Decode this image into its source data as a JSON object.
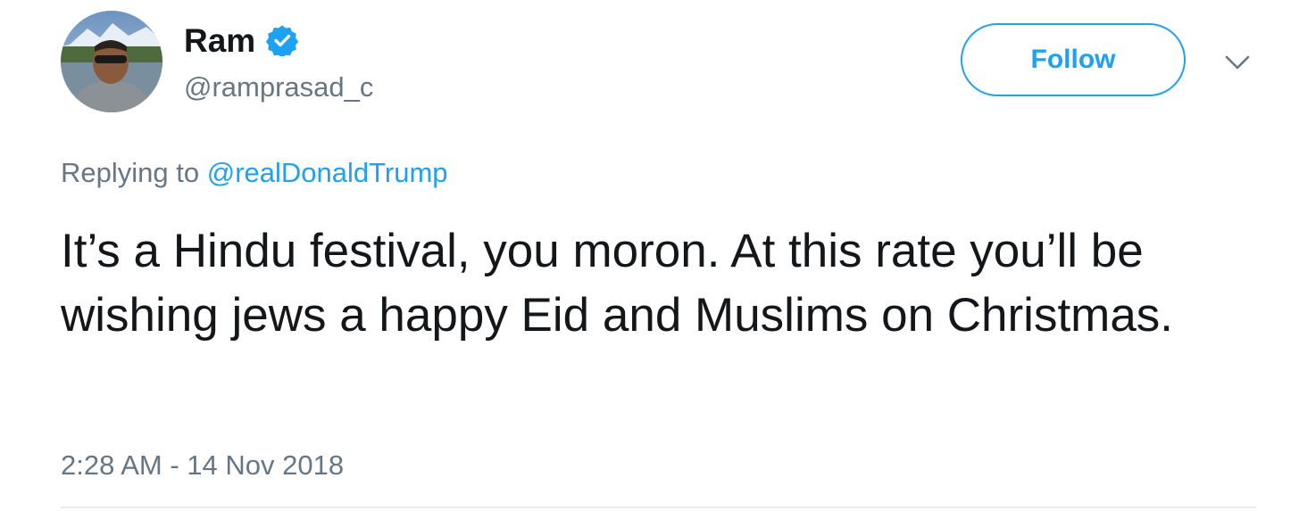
{
  "user": {
    "display_name": "Ram",
    "handle": "@ramprasad_c",
    "verified": true,
    "avatar_icon": "profile-photo"
  },
  "actions": {
    "follow_label": "Follow",
    "caret_icon": "chevron-down-icon"
  },
  "reply": {
    "prefix": "Replying to",
    "mention": "@realDonaldTrump"
  },
  "tweet": {
    "text": "It’s a Hindu festival, you moron. At this rate you’ll be wishing jews a happy Eid and Muslims on Christmas.",
    "timestamp": "2:28 AM - 14 Nov 2018"
  },
  "colors": {
    "accent": "#1da1f2",
    "secondary_text": "#657786",
    "primary_text": "#14171a",
    "divider": "#e6ecf0"
  }
}
